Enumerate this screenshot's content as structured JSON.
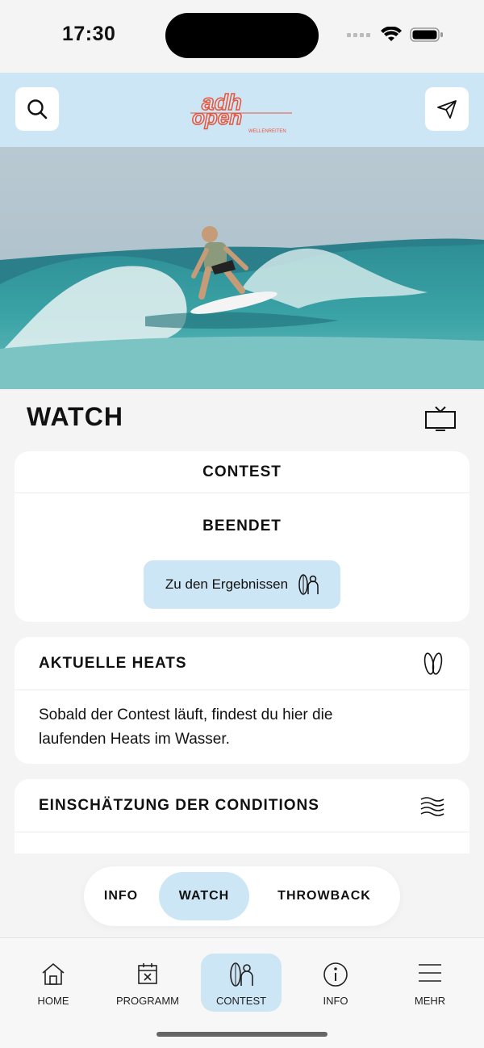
{
  "status": {
    "time": "17:30"
  },
  "header": {
    "logo_line1": "adh",
    "logo_line2": "open",
    "logo_sub": "WELLENREITEN"
  },
  "page": {
    "title": "WATCH"
  },
  "contest_card": {
    "heading": "CONTEST",
    "status": "BEENDET",
    "results_button": "Zu den Ergebnissen"
  },
  "heats_card": {
    "heading": "AKTUELLE HEATS",
    "line1": "Sobald der Contest läuft, findest du hier die",
    "line2": "laufenden Heats im Wasser."
  },
  "conditions_card": {
    "heading": "EINSCHÄTZUNG DER CONDITIONS"
  },
  "segment": {
    "items": [
      "INFO",
      "WATCH",
      "THROWBACK"
    ],
    "selected": "WATCH"
  },
  "tabbar": {
    "items": [
      {
        "label": "HOME",
        "icon": "home-icon"
      },
      {
        "label": "PROGRAMM",
        "icon": "calendar-icon"
      },
      {
        "label": "CONTEST",
        "icon": "surfboard-icon"
      },
      {
        "label": "INFO",
        "icon": "info-icon"
      },
      {
        "label": "MEHR",
        "icon": "menu-icon"
      }
    ],
    "active": "CONTEST"
  },
  "colors": {
    "accent": "#cde6f6",
    "logo": "#e8553a",
    "background": "#f4f4f4"
  }
}
